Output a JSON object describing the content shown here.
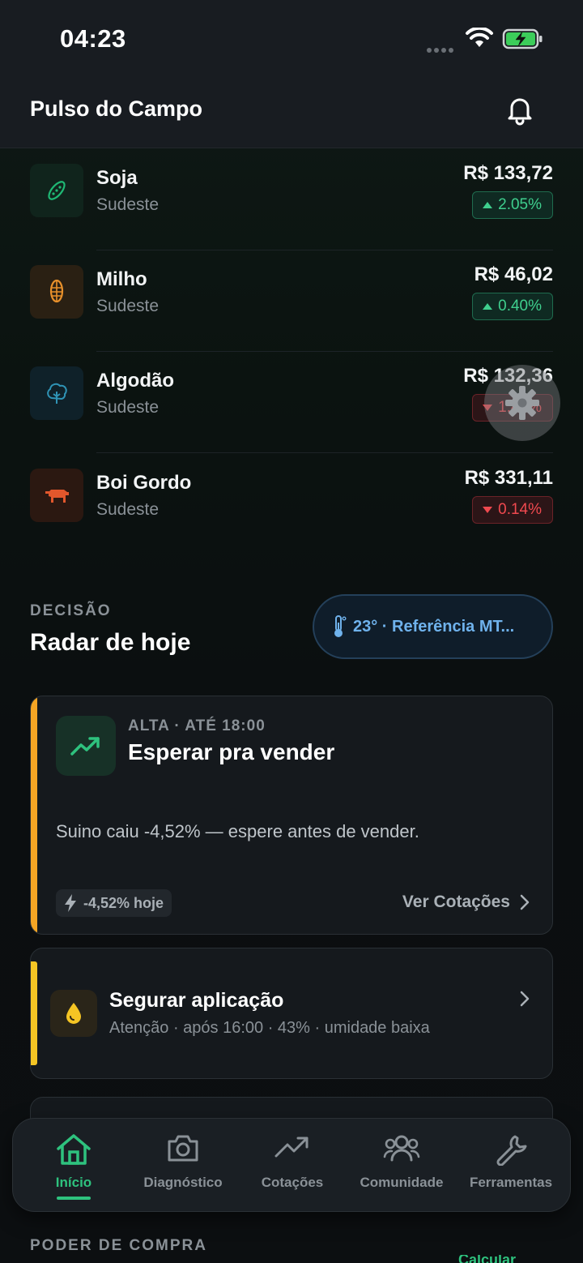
{
  "status_bar": {
    "time": "04:23"
  },
  "header": {
    "title": "Pulso do Campo",
    "bell_icon": "bell-icon"
  },
  "commodities": [
    {
      "name": "Soja",
      "region": "Sudeste",
      "price": "R$ 133,72",
      "change": "2.05%",
      "direction": "up",
      "icon": "soy-icon",
      "icon_bg": "#10241c",
      "icon_color": "#1fb874"
    },
    {
      "name": "Milho",
      "region": "Sudeste",
      "price": "R$ 46,02",
      "change": "0.40%",
      "direction": "up",
      "icon": "corn-icon",
      "icon_bg": "#2a2013",
      "icon_color": "#e8902b"
    },
    {
      "name": "Algodão",
      "region": "Sudeste",
      "price": "R$ 132,36",
      "change": "1.42%",
      "direction": "down",
      "icon": "cotton-icon",
      "icon_bg": "#0f2129",
      "icon_color": "#2f93b5"
    },
    {
      "name": "Boi Gordo",
      "region": "Sudeste",
      "price": "R$ 331,11",
      "change": "0.14%",
      "direction": "down",
      "icon": "cattle-icon",
      "icon_bg": "#2b1811",
      "icon_color": "#e2572c"
    }
  ],
  "radar": {
    "eyebrow": "DECISÃO",
    "title": "Radar de hoje",
    "weather": "23° · Referência MT..."
  },
  "alert_card": {
    "eyebrow": "ALTA · ATÉ 18:00",
    "title": "Esperar pra vender",
    "body": "Suino caiu -4,52% — espere antes de vender.",
    "chip": "-4,52% hoje",
    "link": "Ver Cotações",
    "accent": "#f5a524"
  },
  "hold_card": {
    "title": "Segurar aplicação",
    "subtitle": "Atenção · após 16:00 · 43% · umidade baixa",
    "accent": "#f5c524"
  },
  "nav": [
    {
      "label": "Início",
      "icon": "home-icon",
      "active": true
    },
    {
      "label": "Diagnóstico",
      "icon": "camera-icon",
      "active": false
    },
    {
      "label": "Cotações",
      "icon": "trend-up-icon",
      "active": false
    },
    {
      "label": "Comunidade",
      "icon": "users-icon",
      "active": false
    },
    {
      "label": "Ferramentas",
      "icon": "wrench-icon",
      "active": false
    }
  ],
  "footer": {
    "eyebrow": "PODER DE COMPRA",
    "peek": "Calcular"
  },
  "colors": {
    "up": "#3fcf8e",
    "down": "#f0494f",
    "accent_green": "#2ec27e"
  }
}
